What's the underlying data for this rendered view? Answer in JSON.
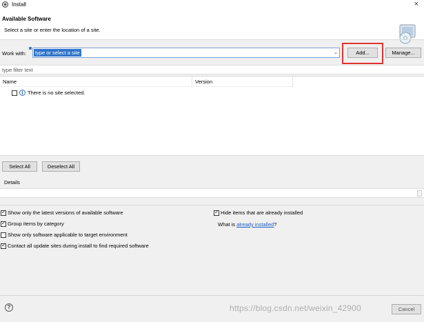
{
  "window": {
    "title": "Install"
  },
  "header": {
    "title": "Available Software",
    "subtitle": "Select a site or enter the location of a site."
  },
  "work_with": {
    "label": "Work with:",
    "value": "type or select a site",
    "add_label": "Add...",
    "manage_label": "Manage..."
  },
  "filter": {
    "placeholder": "type filter text"
  },
  "table": {
    "columns": [
      "Name",
      "Version"
    ],
    "rows": [
      {
        "text": "There is no site selected.",
        "checked": false
      }
    ]
  },
  "selection": {
    "select_all_label": "Select All",
    "deselect_all_label": "Deselect All"
  },
  "details": {
    "label": "Details"
  },
  "options": {
    "latest_versions": {
      "label": "Show only the latest versions of available software",
      "checked": true
    },
    "group_by_category": {
      "label": "Group items by category",
      "checked": true
    },
    "target_env": {
      "label": "Show only software applicable to target environment",
      "checked": false
    },
    "contact_sites": {
      "label": "Contact all update sites during install to find required software",
      "checked": true
    },
    "hide_installed": {
      "label": "Hide items that are already installed",
      "checked": true
    },
    "what_is": {
      "prefix": "What is ",
      "link": "already installed",
      "suffix": "?"
    }
  },
  "footer": {
    "cancel_label": "Cancel",
    "watermark": "https://blog.csdn.net/weixin_42900"
  },
  "colors": {
    "selection": "#2f74c9",
    "link": "#1f5ec5",
    "highlight": "#e0332f"
  }
}
